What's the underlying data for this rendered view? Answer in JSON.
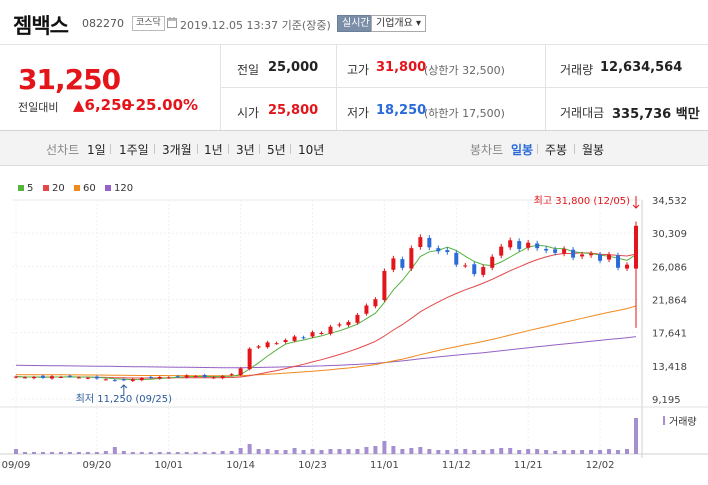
{
  "header": {
    "name": "젬백스",
    "code": "082270",
    "market": "코스닥",
    "datetime": "2019.12.05 13:37 기준(장중)",
    "realtime_btn": "실시간",
    "company_btn": "기업개요 ▾"
  },
  "quote": {
    "price": "31,250",
    "prev_label": "전일대비",
    "change": "▲6,250",
    "change_pct": "+25.00%",
    "prev_close_label": "전일",
    "prev_close": "25,000",
    "high_label": "고가",
    "high": "31,800",
    "upper_limit": "(상한가 32,500)",
    "volume_label": "거래량",
    "volume": "12,634,564",
    "open_label": "시가",
    "open": "25,800",
    "low_label": "저가",
    "low": "18,250",
    "lower_limit": "(하한가 17,500)",
    "amount_label": "거래대금",
    "amount": "335,736 백만"
  },
  "tabs": {
    "line_label": "선차트",
    "line_periods": [
      "1일",
      "1주일",
      "3개월",
      "1년",
      "3년",
      "5년",
      "10년"
    ],
    "candle_label": "봉차트",
    "candle_periods": [
      "일봉",
      "주봉",
      "월봉"
    ],
    "active_candle": 0
  },
  "colors": {
    "up": "#e3141a",
    "down": "#2a6bd8",
    "ma5": "#55b340",
    "ma20": "#e34848",
    "ma60": "#ef8a1c",
    "ma120": "#9562c6",
    "volume": "#a58fd0"
  },
  "chart_data": {
    "type": "candlestick",
    "legend": [
      "5",
      "20",
      "60",
      "120"
    ],
    "ylim": [
      9195,
      34532
    ],
    "y_ticks": [
      "34,532",
      "30,309",
      "26,086",
      "21,864",
      "17,641",
      "13,418",
      "9,195"
    ],
    "x_labels": [
      "09/09",
      "09/20",
      "10/01",
      "10/14",
      "10/23",
      "11/01",
      "11/12",
      "11/21",
      "12/02"
    ],
    "x_label_index": [
      0,
      9,
      17,
      25,
      33,
      41,
      49,
      57,
      65
    ],
    "annot_high": "최고 31,800 (12/05)",
    "annot_low": "최저 11,250 (09/25)",
    "high_index": 69,
    "low_index": 12,
    "volume_label": "거래량",
    "closes": [
      12050,
      11950,
      12000,
      11900,
      12100,
      12000,
      12050,
      11950,
      11900,
      11800,
      11700,
      11550,
      11600,
      11700,
      11850,
      11900,
      12000,
      11950,
      12050,
      12200,
      12100,
      12000,
      11950,
      12100,
      12350,
      13100,
      15600,
      15900,
      16400,
      16300,
      16700,
      17150,
      17000,
      17700,
      17600,
      18400,
      18700,
      19000,
      19900,
      21100,
      21900,
      25500,
      27100,
      25900,
      28400,
      29800,
      28500,
      28000,
      27900,
      26300,
      26200,
      25100,
      26000,
      27300,
      28600,
      29400,
      28300,
      29100,
      28400,
      28100,
      27800,
      28300,
      27200,
      27600,
      27700,
      26800,
      27600,
      25900,
      26300,
      31250
    ],
    "volume": [
      5,
      2,
      2,
      2,
      2,
      2,
      2,
      2,
      2,
      2,
      3,
      7,
      3,
      2,
      2,
      2,
      2,
      2,
      2,
      2,
      2,
      2,
      2,
      3,
      3,
      6,
      10,
      5,
      5,
      4,
      4,
      6,
      4,
      5,
      4,
      5,
      5,
      5,
      5,
      7,
      8,
      13,
      8,
      5,
      6,
      7,
      5,
      4,
      4,
      5,
      5,
      4,
      4,
      5,
      6,
      6,
      4,
      5,
      5,
      4,
      3,
      4,
      4,
      4,
      4,
      4,
      5,
      4,
      5,
      36
    ]
  }
}
